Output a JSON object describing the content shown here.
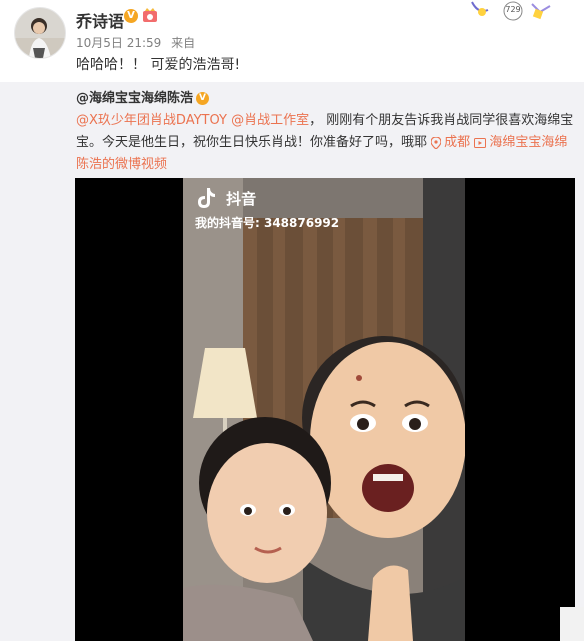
{
  "header": {
    "username": "乔诗语",
    "verified_mark": "V",
    "date": "10月5日 21:59",
    "source": "来自"
  },
  "post": {
    "text": "哈哈哈！！ 可爱的浩浩哥!"
  },
  "header_decor": {
    "count": "729"
  },
  "repost": {
    "original_user": "@海绵宝宝海绵陈浩",
    "verified_mark": "V",
    "mention_1": "@X玖少年团肖战DAYTOY",
    "mention_2": "@肖战工作室",
    "text": "， 刚刚有个朋友告诉我肖战同学很喜欢海绵宝宝。今天是他生日，祝你生日快乐肖战！你准备好了吗，哦耶",
    "location": "成都",
    "video_link": "海绵宝宝海绵陈浩的微博视频"
  },
  "video": {
    "app_name": "抖音",
    "account_id": "我的抖音号: 348876992"
  },
  "colors": {
    "link": "#eb7350",
    "repost_bg": "#f2f2f5",
    "badge": "#f5a623"
  }
}
